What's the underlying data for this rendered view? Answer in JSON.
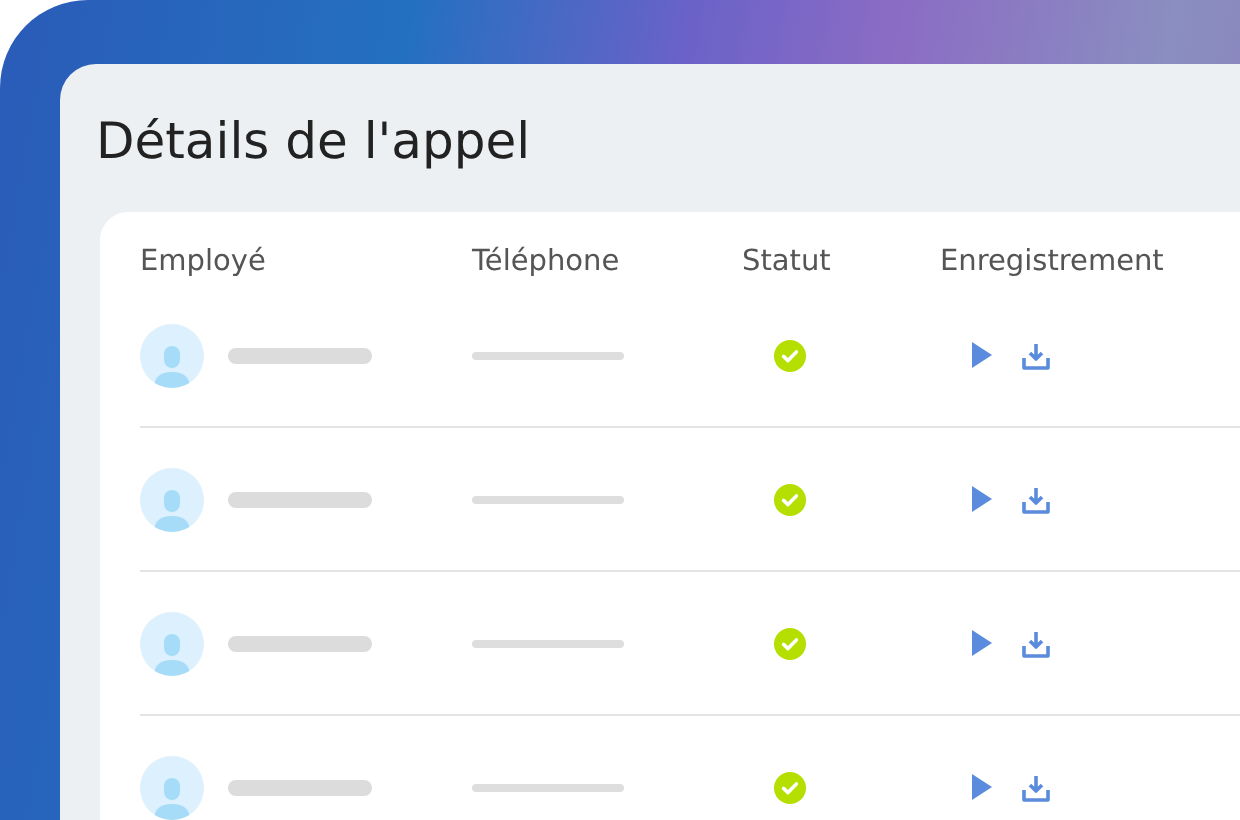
{
  "panel": {
    "title": "Détails de l'appel"
  },
  "table": {
    "columns": [
      "Employé",
      "Téléphone",
      "Statut",
      "Enregistrement"
    ],
    "rows": [
      {
        "kind": "success"
      },
      {
        "kind": "success"
      },
      {
        "kind": "success"
      },
      {
        "kind": "success"
      }
    ]
  }
}
